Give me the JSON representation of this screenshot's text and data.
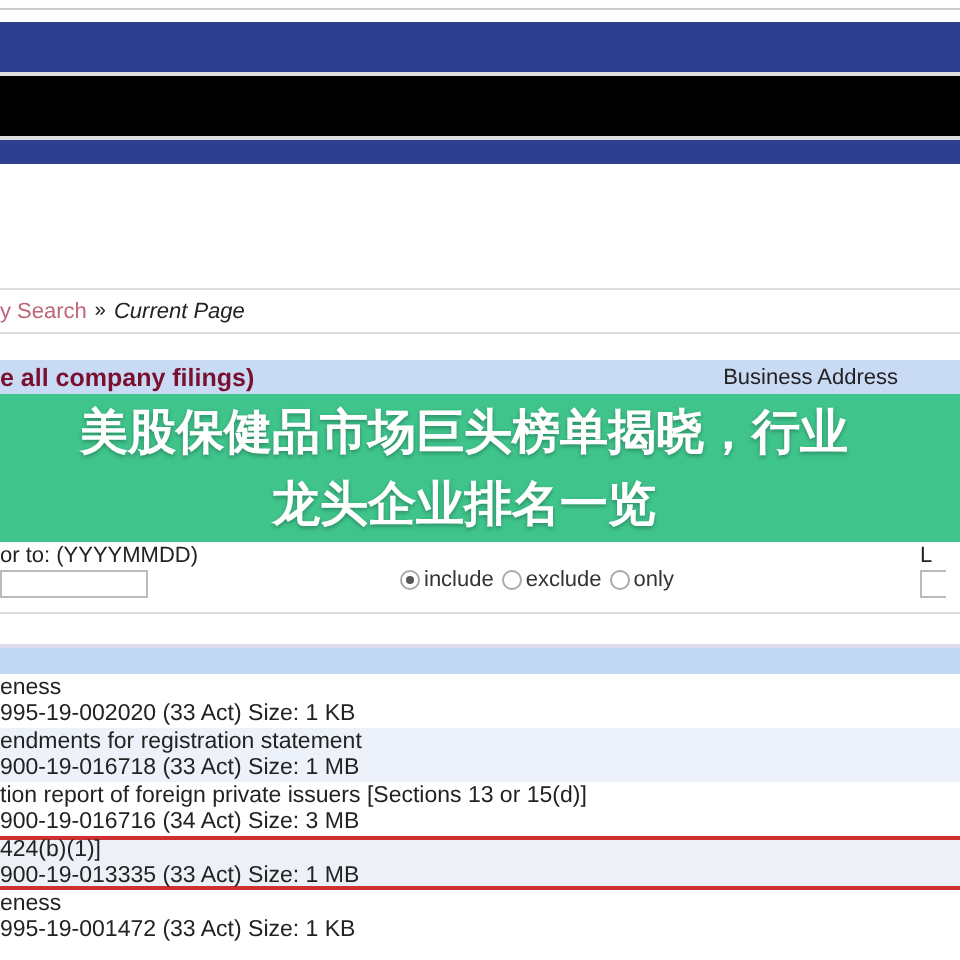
{
  "breadcrumb": {
    "link": "y Search",
    "separator": "»",
    "current": "Current Page"
  },
  "filings_header": {
    "title": "e all company filings)",
    "business_address_label": "Business Address"
  },
  "banner": {
    "title": "美股保健品市场巨头榜单揭晓，行业龙头企业排名一览"
  },
  "form": {
    "date_label": "or to: (YYYYMMDD)",
    "radios": [
      {
        "label": "include",
        "selected": true
      },
      {
        "label": "exclude",
        "selected": false
      },
      {
        "label": "only",
        "selected": false
      }
    ],
    "limit_label": "L"
  },
  "rows": [
    {
      "description": "eness",
      "details": "995-19-002020 (33 Act)  Size: 1 KB",
      "highlighted": false
    },
    {
      "description": "endments for registration statement",
      "details": "900-19-016718 (33 Act)  Size: 1 MB",
      "highlighted": false
    },
    {
      "description": "tion report of foreign private issuers [Sections 13 or 15(d)]",
      "details": "900-19-016716 (34 Act)  Size: 3 MB",
      "highlighted": false
    },
    {
      "description": "424(b)(1)]",
      "details": "900-19-013335 (33 Act)  Size: 1 MB",
      "highlighted": true
    },
    {
      "description": "eness",
      "details": "995-19-001472 (33 Act)  Size: 1 KB",
      "highlighted": false
    }
  ]
}
